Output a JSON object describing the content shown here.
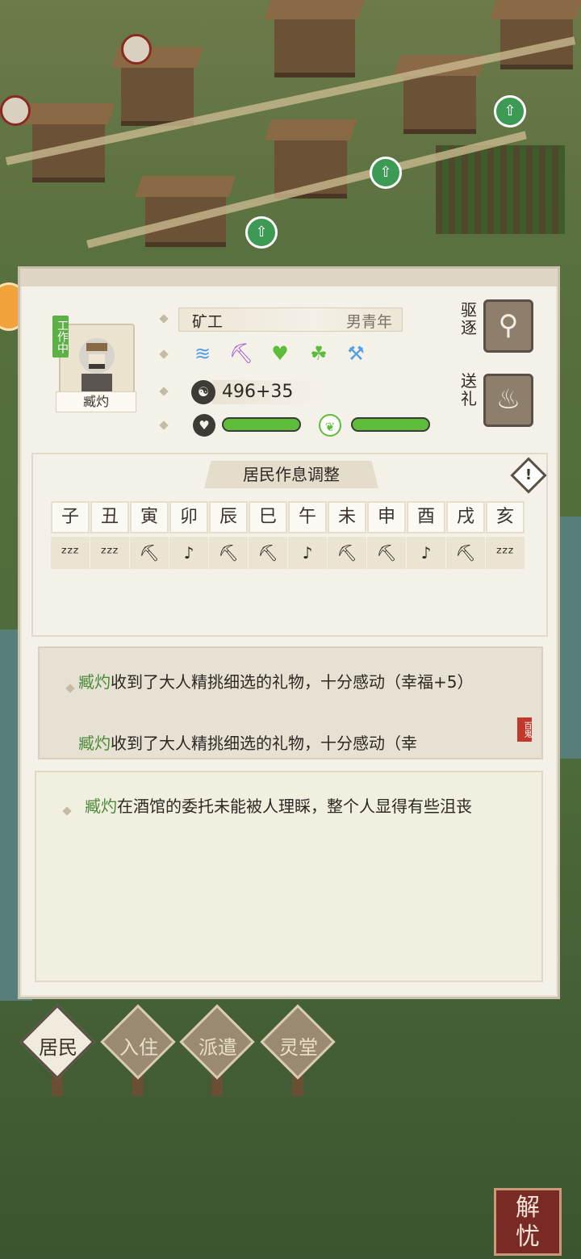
{
  "resident": {
    "name": "臧灼",
    "status_tag": "工作中",
    "job": "矿工",
    "attribute": "男青年",
    "coins": "496+35",
    "skill_icons": [
      "fish-icon",
      "pickaxe-icon",
      "heart-leaf-icon",
      "plant-icon",
      "hammer-icon"
    ],
    "happiness_level": 1.0,
    "health_level": 1.0
  },
  "actions": {
    "expel_label": "驱逐",
    "gift_label": "送礼"
  },
  "schedule": {
    "title": "居民作息调整",
    "hours": [
      {
        "name": "子",
        "activity": "sleep"
      },
      {
        "name": "丑",
        "activity": "sleep"
      },
      {
        "name": "寅",
        "activity": "work"
      },
      {
        "name": "卯",
        "activity": "leisure"
      },
      {
        "name": "辰",
        "activity": "work"
      },
      {
        "name": "巳",
        "activity": "work"
      },
      {
        "name": "午",
        "activity": "leisure"
      },
      {
        "name": "未",
        "activity": "work"
      },
      {
        "name": "申",
        "activity": "work"
      },
      {
        "name": "酉",
        "activity": "leisure"
      },
      {
        "name": "戌",
        "activity": "work"
      },
      {
        "name": "亥",
        "activity": "sleep"
      }
    ]
  },
  "log": {
    "entries": [
      {
        "name": "臧灼",
        "text": "收到了大人精挑细选的礼物，十分感动（幸福+5）"
      },
      {
        "name": "臧灼",
        "text": "收到了大人精挑细选的礼物，十分感动（幸"
      }
    ],
    "stamp": "百鬼",
    "detail": {
      "name": "臧灼",
      "text": "在酒馆的委托未能被人理睬，整个人显得有些沮丧"
    }
  },
  "tabs": [
    {
      "label": "居民",
      "active": true
    },
    {
      "label": "入住",
      "active": false
    },
    {
      "label": "派遣",
      "active": false
    },
    {
      "label": "灵堂",
      "active": false
    }
  ],
  "seal_label": "解忧",
  "colors": {
    "accent_green": "#5dbd3a",
    "name_green": "#4a8a3a",
    "panel": "#f4f1e8"
  }
}
